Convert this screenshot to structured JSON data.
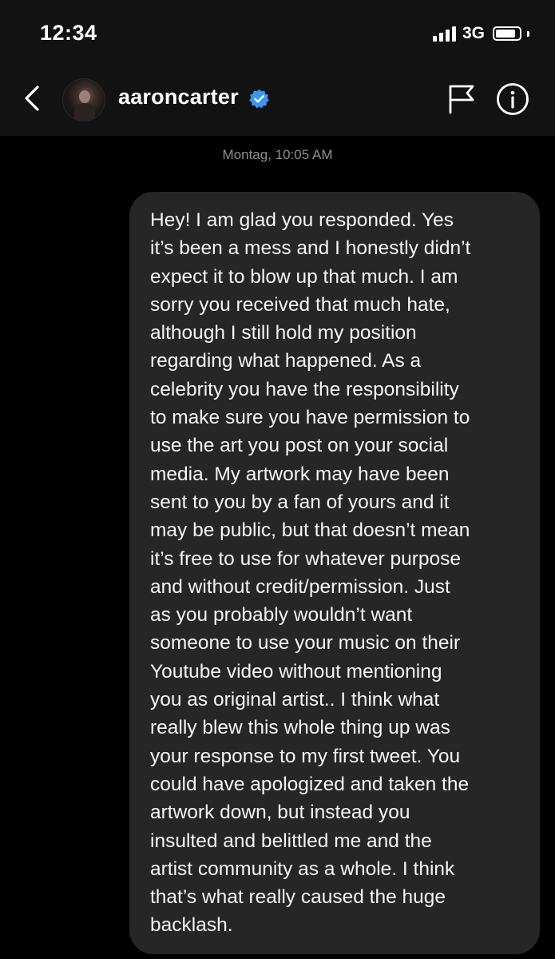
{
  "status_bar": {
    "time": "12:34",
    "network": "3G",
    "battery_level": 0.85
  },
  "header": {
    "username": "aaroncarter",
    "verified": true,
    "back_icon": "chevron-left-icon",
    "verified_icon": "verified-badge-icon",
    "flag_icon": "flag-icon",
    "info_icon": "info-icon"
  },
  "conversation": {
    "timestamp": "Montag, 10:05 AM",
    "messages": [
      {
        "sender": "self",
        "lines": [
          "Hey! I am glad you responded. Yes",
          "it’s been a mess and I honestly didn’t",
          "expect it to blow up that much. I am",
          "sorry you received that much hate,",
          "although I still hold my position",
          "regarding what happened. As a",
          "celebrity you have the responsibility",
          "to make sure you have permission to",
          "use the art you post on your social",
          "media. My artwork may have been",
          "sent to you by a fan of yours and it",
          "may be public, but that doesn’t mean",
          "it’s free to use for whatever purpose",
          "and without credit/permission. Just",
          "as you probably wouldn’t want",
          "someone to use your music on their",
          "Youtube video without mentioning",
          "you as original artist.. I think what",
          "really blew this whole thing up was",
          "your response to my first tweet. You",
          "could have apologized and taken the",
          "artwork down, but instead you",
          "insulted and belittled me and the",
          "artist community as a whole. I think",
          "that’s what really caused the huge",
          "backlash."
        ]
      }
    ]
  },
  "colors": {
    "background": "#000000",
    "header_background": "#121212",
    "bubble_background": "#262626",
    "timestamp_text": "#8e8e8e",
    "verified_blue": "#3897f0"
  }
}
